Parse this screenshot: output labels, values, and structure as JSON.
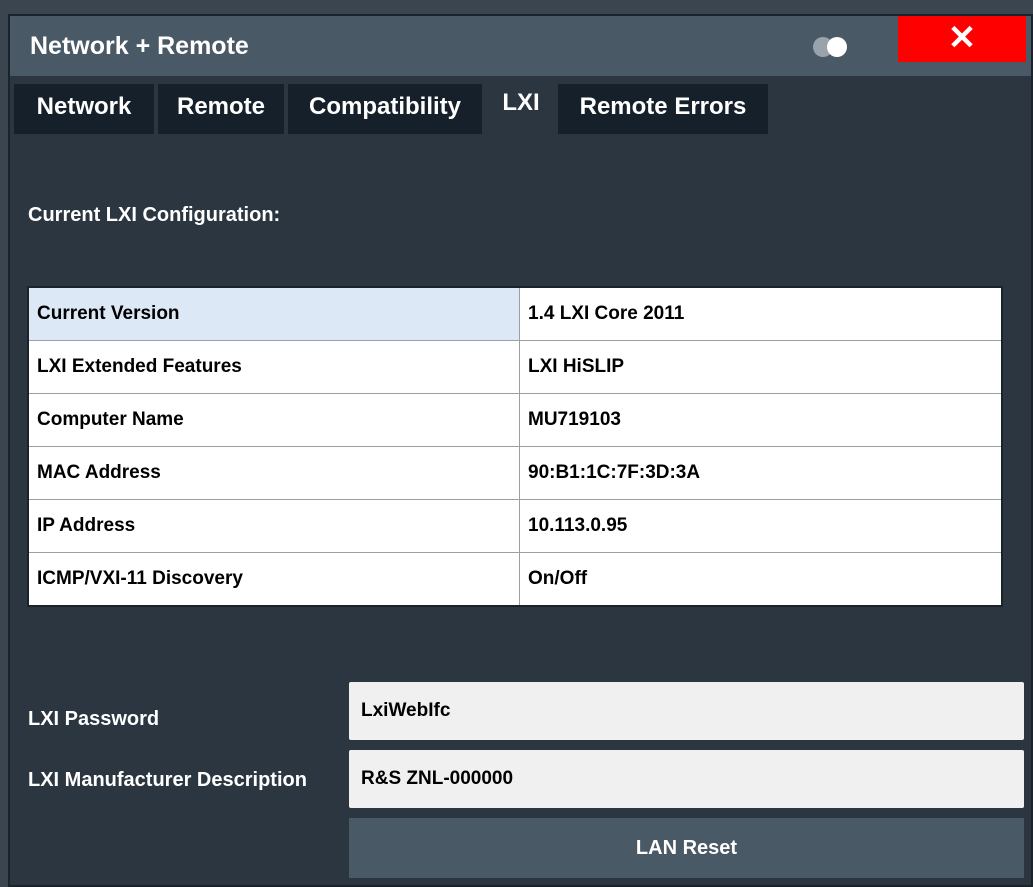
{
  "window": {
    "title": "Network + Remote",
    "close_label": "✕"
  },
  "tabs": [
    {
      "label": "Network"
    },
    {
      "label": "Remote"
    },
    {
      "label": "Compatibility"
    },
    {
      "label": "LXI"
    },
    {
      "label": "Remote Errors"
    }
  ],
  "active_tab": "LXI",
  "section_label": "Current LXI Configuration:",
  "config_table": [
    {
      "key": "Current Version",
      "value": "1.4 LXI Core 2011"
    },
    {
      "key": "LXI Extended Features",
      "value": "LXI HiSLIP"
    },
    {
      "key": "Computer Name",
      "value": "MU719103"
    },
    {
      "key": "MAC Address",
      "value": "90:B1:1C:7F:3D:3A"
    },
    {
      "key": "IP Address",
      "value": "10.113.0.95"
    },
    {
      "key": "ICMP/VXI-11 Discovery",
      "value": "On/Off"
    }
  ],
  "password": {
    "label": "LXI Password",
    "value": "LxiWebIfc"
  },
  "manufacturer": {
    "label": "LXI Manufacturer Description",
    "value": "R&S ZNL-000000"
  },
  "lan_reset_label": "LAN Reset",
  "colors": {
    "close": "#ff0000",
    "background": "#2b3640",
    "titlebar": "#4a5966"
  },
  "icons": {
    "toggle": "theme-toggle-icon",
    "close": "close-icon"
  }
}
